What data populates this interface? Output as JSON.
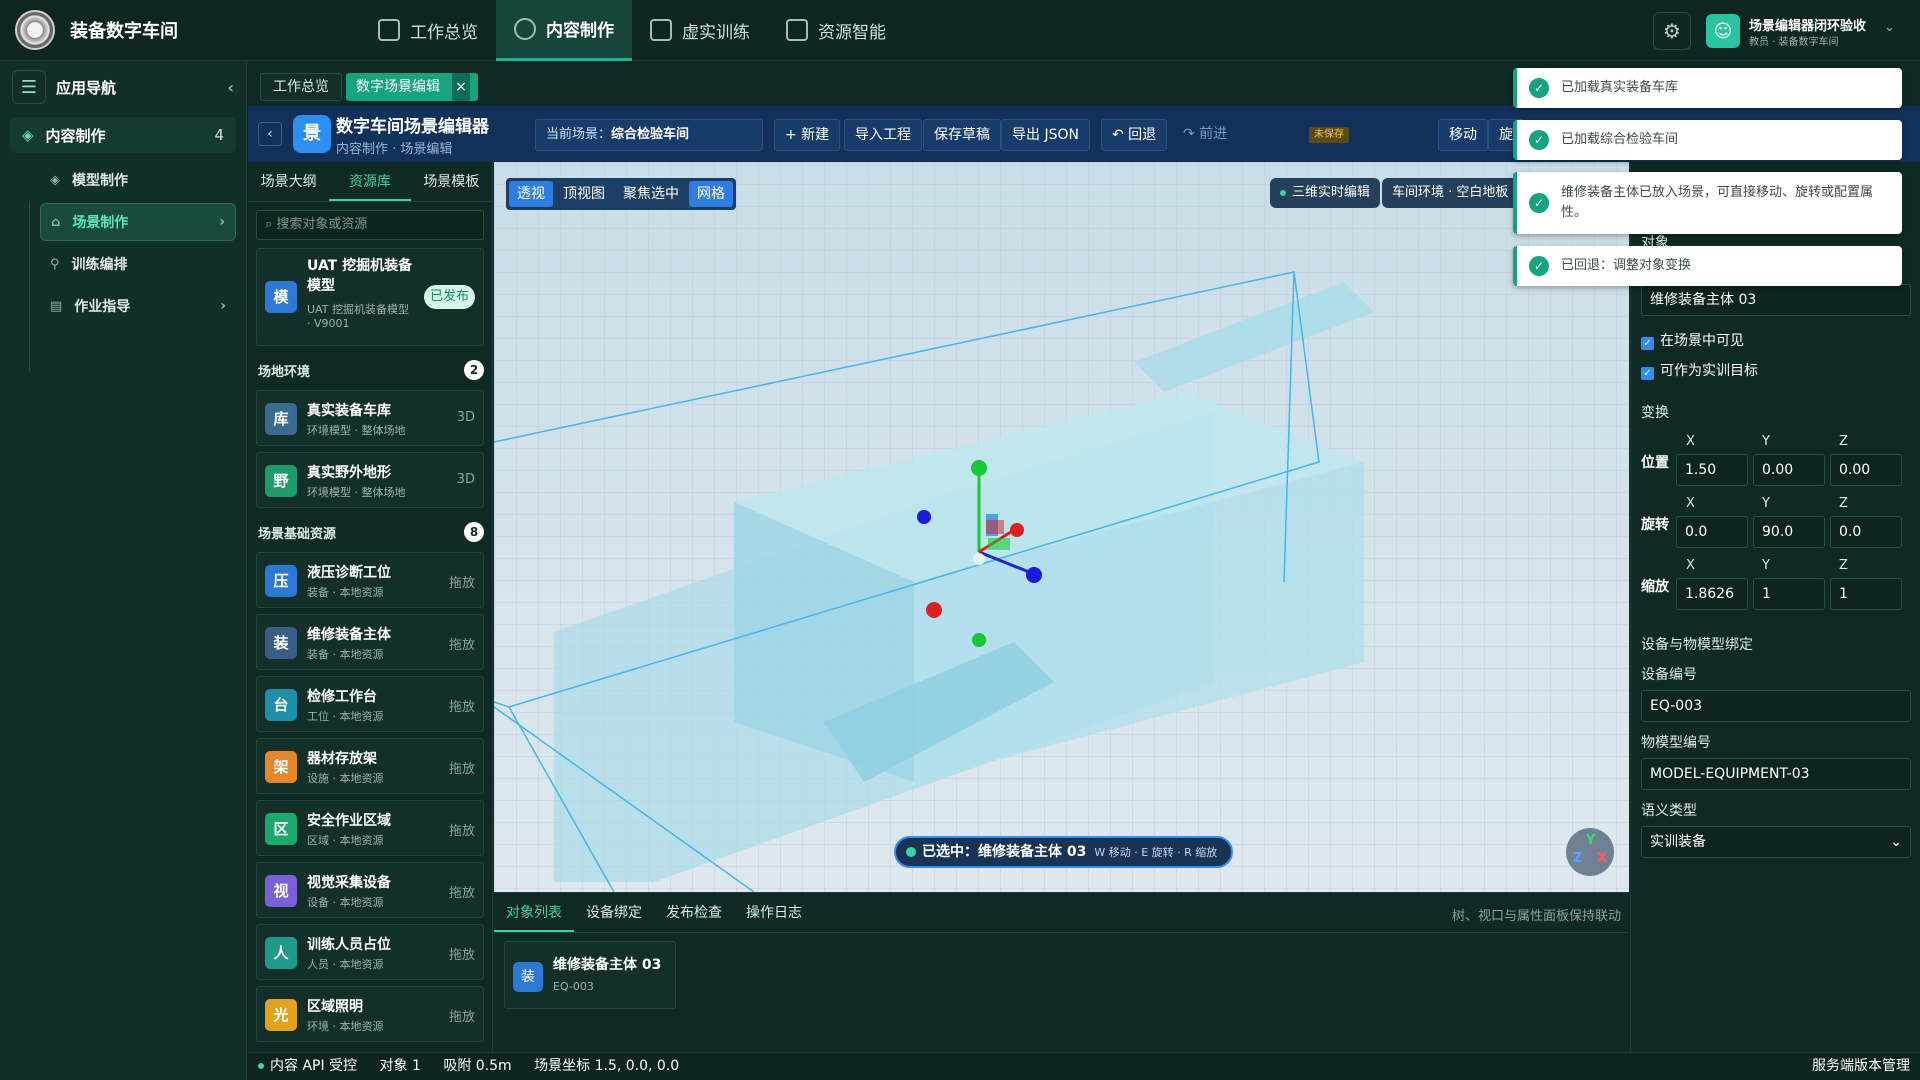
{
  "app": {
    "title": "装备数字车间"
  },
  "topnav": [
    {
      "label": "工作总览",
      "active": false
    },
    {
      "label": "内容制作",
      "active": true
    },
    {
      "label": "虚实训练",
      "active": false
    },
    {
      "label": "资源智能",
      "active": false
    }
  ],
  "user": {
    "name": "场景编辑器闭环验收",
    "role": "教员 · 装备数字车间"
  },
  "leftnav": {
    "header": "应用导航",
    "group": {
      "label": "内容制作",
      "count": "4"
    },
    "items": [
      {
        "label": "模型制作"
      },
      {
        "label": "场景制作"
      },
      {
        "label": "训练编排"
      },
      {
        "label": "作业指导"
      }
    ]
  },
  "tabs": {
    "tab1": "工作总览",
    "tab2": "数字场景编辑"
  },
  "editor": {
    "icon": "景",
    "title": "数字车间场景编辑器",
    "breadcrumb": "内容制作 · 场景编辑",
    "scene_label": "当前场景：",
    "scene_value": "综合检验车间",
    "new_btn": "+ 新建",
    "import_btn": "导入工程",
    "save_btn": "保存草稿",
    "export_btn": "导出 JSON",
    "undo_btn": "↶ 回退",
    "redo_btn": "↷ 前进",
    "unsaved": "未保存",
    "move_btn": "移动",
    "rotate_btn": "旋"
  },
  "respanel": {
    "tabs": [
      "场景大纲",
      "资源库",
      "场景模板"
    ],
    "search_placeholder": "搜索对象或资源",
    "featured": {
      "icon": "模",
      "title1": "UAT 挖掘机装备",
      "title2": "模型",
      "sub1": "UAT 挖掘机装备模型",
      "sub2": "· V9001",
      "badge": "已发布"
    },
    "section1": {
      "label": "场地环境",
      "count": "2"
    },
    "env": [
      {
        "icon": "库",
        "title": "真实装备车库",
        "sub": "环境模型 · 整体场地",
        "tag": "3D",
        "color": "#3a6a8c"
      },
      {
        "icon": "野",
        "title": "真实野外地形",
        "sub": "环境模型 · 整体场地",
        "tag": "3D",
        "color": "#1f9a6d"
      }
    ],
    "section2": {
      "label": "场景基础资源",
      "count": "8"
    },
    "base": [
      {
        "icon": "压",
        "title": "液压诊断工位",
        "sub": "装备 · 本地资源",
        "tag": "拖放",
        "color": "#2b79d4"
      },
      {
        "icon": "装",
        "title": "维修装备主体",
        "sub": "装备 · 本地资源",
        "tag": "拖放",
        "color": "#3a5f86"
      },
      {
        "icon": "台",
        "title": "检修工作台",
        "sub": "工位 · 本地资源",
        "tag": "拖放",
        "color": "#1f8ea8"
      },
      {
        "icon": "架",
        "title": "器材存放架",
        "sub": "设施 · 本地资源",
        "tag": "拖放",
        "color": "#e4862b"
      },
      {
        "icon": "区",
        "title": "安全作业区域",
        "sub": "区域 · 本地资源",
        "tag": "拖放",
        "color": "#1fa86d"
      },
      {
        "icon": "视",
        "title": "视觉采集设备",
        "sub": "设备 · 本地资源",
        "tag": "拖放",
        "color": "#7a5fd6"
      },
      {
        "icon": "人",
        "title": "训练人员占位",
        "sub": "人员 · 本地资源",
        "tag": "拖放",
        "color": "#1f9a8a"
      },
      {
        "icon": "光",
        "title": "区域照明",
        "sub": "环境 · 本地资源",
        "tag": "拖放",
        "color": "#e0a21f"
      }
    ]
  },
  "viewport": {
    "modes": [
      "透视",
      "顶视图",
      "聚焦选中",
      "网格"
    ],
    "pill1": "三维实时编辑",
    "pill2": "车间环境 · 空白地板",
    "selected_label": "已选中：",
    "selected_name": "维修装备主体 03",
    "selected_hint": "W 移动 · E 旋转 · R 缩放",
    "gizmo": {
      "y": "Y",
      "z": "Z",
      "x": "X"
    }
  },
  "bottom": {
    "tabs": [
      "对象列表",
      "设备绑定",
      "发布检查",
      "操作日志"
    ],
    "hint": "树、视口与属性面板保持联动",
    "obj": {
      "icon": "装",
      "title": "维修装备主体 03",
      "sub": "EQ-003"
    }
  },
  "props": {
    "object_label": "对象",
    "object_name": "维修装备主体 03",
    "visible": "在场景中可见",
    "target": "可作为实训目标",
    "transform": "变换",
    "axes": [
      "X",
      "Y",
      "Z"
    ],
    "position_label": "位置",
    "position": [
      "1.50",
      "0.00",
      "0.00"
    ],
    "rotation_label": "旋转",
    "rotation": [
      "0.0",
      "90.0",
      "0.0"
    ],
    "scale_label": "缩放",
    "scale": [
      "1.8626",
      "1",
      "1"
    ],
    "binding_title": "设备与物模型绑定",
    "device_label": "设备编号",
    "device_value": "EQ-003",
    "model_label": "物模型编号",
    "model_value": "MODEL-EQUIPMENT-03",
    "semantic_label": "语义类型",
    "semantic_value": "实训装备"
  },
  "status": {
    "api": "内容 API 受控",
    "objects": "对象 1",
    "snap": "吸附 0.5m",
    "coord": "场景坐标 1.5, 0.0, 0.0",
    "right": "服务端版本管理"
  },
  "toasts": [
    "已加载真实装备车库",
    "已加载综合检验车间",
    "维修装备主体已放入场景，可直接移动、旋转或配置属性。",
    "已回退：调整对象变换"
  ],
  "colors": {
    "accent": "#16a37f",
    "header": "#12315a",
    "primary": "#2f8ff0"
  }
}
